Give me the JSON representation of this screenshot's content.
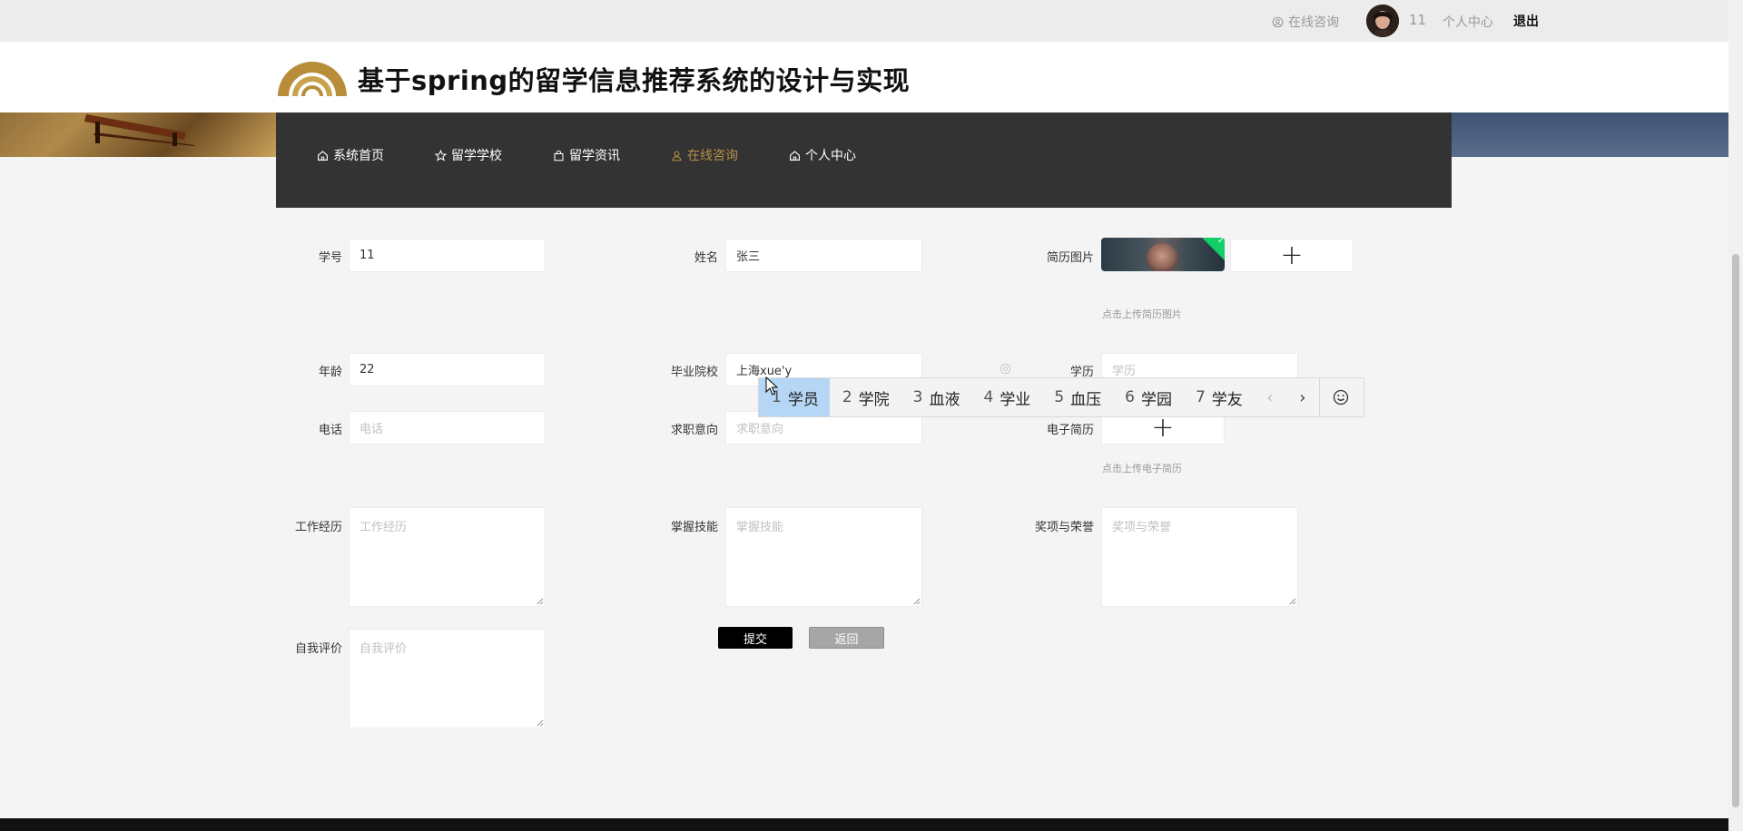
{
  "topbar": {
    "consult": "在线咨询",
    "user_name": "11",
    "personal_center": "个人中心",
    "logout": "退出"
  },
  "header": {
    "title": "基于spring的留学信息推荐系统的设计与实现"
  },
  "nav": {
    "items": [
      {
        "label": "系统首页",
        "icon": "home-icon"
      },
      {
        "label": "留学学校",
        "icon": "star-icon"
      },
      {
        "label": "留学资讯",
        "icon": "bag-icon"
      },
      {
        "label": "在线咨询",
        "icon": "user-icon",
        "active": true
      },
      {
        "label": "个人中心",
        "icon": "home-icon"
      }
    ],
    "active_color": "#b8904a"
  },
  "form": {
    "student_id": {
      "label": "学号",
      "value": "11"
    },
    "name": {
      "label": "姓名",
      "value": "张三"
    },
    "resume_image": {
      "label": "简历图片",
      "hint": "点击上传简历图片"
    },
    "age": {
      "label": "年龄",
      "value": "22"
    },
    "school": {
      "label": "毕业院校",
      "value": "上海xue'y"
    },
    "education": {
      "label": "学历",
      "placeholder": "学历"
    },
    "phone": {
      "label": "电话",
      "placeholder": "电话"
    },
    "job_intent": {
      "label": "求职意向",
      "placeholder": "求职意向"
    },
    "resume_file": {
      "label": "电子简历",
      "hint": "点击上传电子简历"
    },
    "work_experience": {
      "label": "工作经历",
      "placeholder": "工作经历"
    },
    "skills": {
      "label": "掌握技能",
      "placeholder": "掌握技能"
    },
    "awards": {
      "label": "奖项与荣誉",
      "placeholder": "奖项与荣誉"
    },
    "self_evaluation": {
      "label": "自我评价",
      "placeholder": "自我评价"
    },
    "submit": "提交",
    "back": "返回"
  },
  "ime": {
    "candidates": [
      {
        "num": "1",
        "text": "学员"
      },
      {
        "num": "2",
        "text": "学院"
      },
      {
        "num": "3",
        "text": "血液"
      },
      {
        "num": "4",
        "text": "学业"
      },
      {
        "num": "5",
        "text": "血压"
      },
      {
        "num": "6",
        "text": "学园"
      },
      {
        "num": "7",
        "text": "学友"
      }
    ],
    "selected_index": 0,
    "highlight_color": "#b5d7f5"
  }
}
